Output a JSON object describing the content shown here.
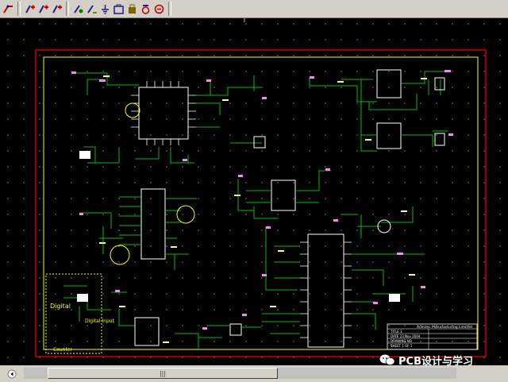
{
  "toolbar": {
    "buttons": [
      {
        "icon": "wire-icon"
      },
      {
        "icon": "bus-icon"
      },
      {
        "icon": "add-part-icon"
      },
      {
        "icon": "add-net-icon"
      },
      {
        "icon": "add-pin-icon"
      },
      {
        "icon": "edit-net-icon"
      },
      {
        "icon": "ground-icon"
      },
      {
        "icon": "power-icon"
      },
      {
        "icon": "lock-icon"
      },
      {
        "icon": "report-icon"
      },
      {
        "icon": "sheet-connector-icon"
      }
    ]
  },
  "schematic": {
    "colors": {
      "background": "#000000",
      "border": "#ff0000",
      "frame": "#ffff00",
      "wire": "#00c000",
      "part": "#ffffff",
      "label": "#ff80ff",
      "net_text": "#ffff80"
    },
    "region_labels": {
      "digital": "Digital",
      "digital_input": "Digital Input",
      "counter": "Counter"
    },
    "title_block": {
      "company": "Acestec Manufacturing Limited",
      "row1": "TITLE 1",
      "row2": "DATE   23 Nov 2004",
      "row3": "DRAWING NO",
      "row4": "SHEET 1 OF 1"
    }
  },
  "scrollbar": {
    "thumb_grip": "|||"
  },
  "watermark": {
    "text": "PCB设计与学习"
  }
}
